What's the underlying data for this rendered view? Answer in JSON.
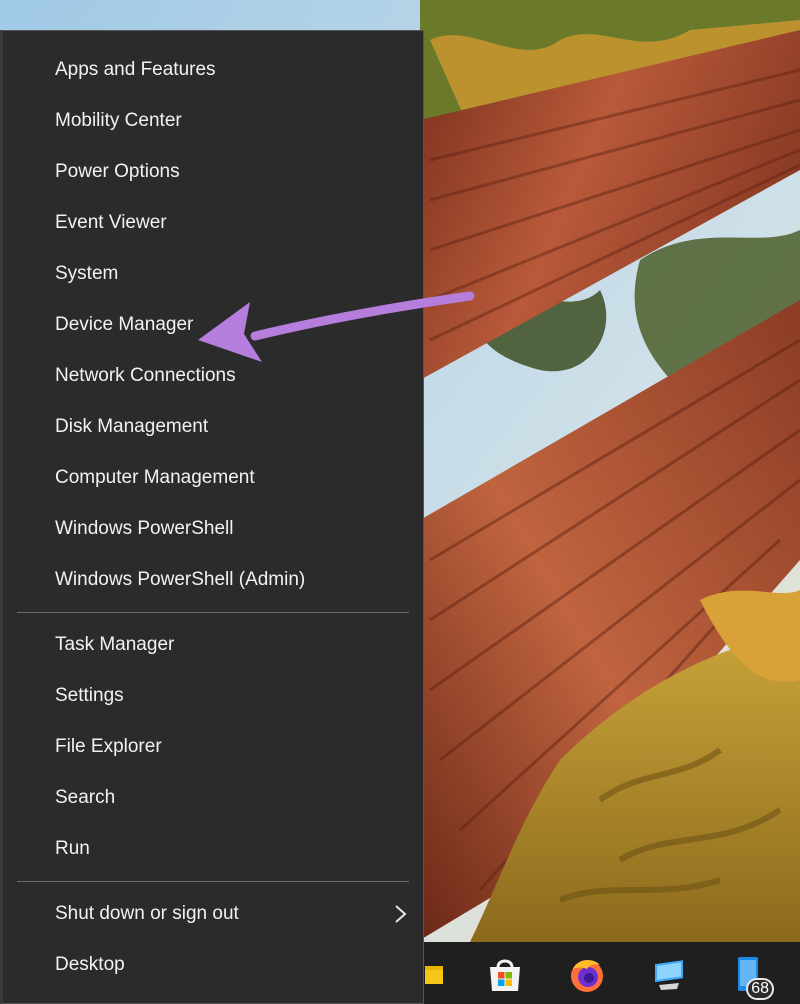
{
  "menu": {
    "items": [
      {
        "label": "Apps and Features",
        "name": "menu-item-apps-and-features"
      },
      {
        "label": "Mobility Center",
        "name": "menu-item-mobility-center"
      },
      {
        "label": "Power Options",
        "name": "menu-item-power-options"
      },
      {
        "label": "Event Viewer",
        "name": "menu-item-event-viewer"
      },
      {
        "label": "System",
        "name": "menu-item-system"
      },
      {
        "label": "Device Manager",
        "name": "menu-item-device-manager"
      },
      {
        "label": "Network Connections",
        "name": "menu-item-network-connections"
      },
      {
        "label": "Disk Management",
        "name": "menu-item-disk-management"
      },
      {
        "label": "Computer Management",
        "name": "menu-item-computer-management"
      },
      {
        "label": "Windows PowerShell",
        "name": "menu-item-windows-powershell"
      },
      {
        "label": "Windows PowerShell (Admin)",
        "name": "menu-item-windows-powershell-admin"
      },
      {
        "label": "Task Manager",
        "name": "menu-item-task-manager"
      },
      {
        "label": "Settings",
        "name": "menu-item-settings"
      },
      {
        "label": "File Explorer",
        "name": "menu-item-file-explorer"
      },
      {
        "label": "Search",
        "name": "menu-item-search"
      },
      {
        "label": "Run",
        "name": "menu-item-run"
      },
      {
        "label": "Shut down or sign out",
        "name": "menu-item-shut-down-or-sign-out"
      },
      {
        "label": "Desktop",
        "name": "menu-item-desktop"
      }
    ],
    "submenu_icon": "chevron-right-icon"
  },
  "taskbar": {
    "icons": [
      {
        "name": "sticky-notes-icon"
      },
      {
        "name": "microsoft-store-icon"
      },
      {
        "name": "firefox-icon"
      },
      {
        "name": "this-pc-icon"
      },
      {
        "name": "phone-link-icon",
        "badge": "68"
      }
    ]
  },
  "annotation": {
    "icon": "pointer-arrow-icon",
    "color": "#b57edc"
  },
  "colors": {
    "menu_background": "#2b2b2b",
    "menu_text": "#f2f2f2",
    "taskbar": "#1f1f1f"
  }
}
